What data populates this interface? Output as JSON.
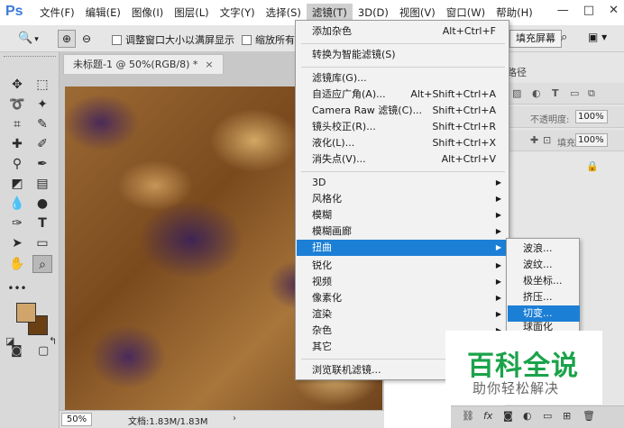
{
  "app": {
    "logo": "Ps"
  },
  "menubar": {
    "items": [
      {
        "label": "文件(F)"
      },
      {
        "label": "编辑(E)"
      },
      {
        "label": "图像(I)"
      },
      {
        "label": "图层(L)"
      },
      {
        "label": "文字(Y)"
      },
      {
        "label": "选择(S)"
      },
      {
        "label": "滤镜(T)"
      },
      {
        "label": "3D(D)"
      },
      {
        "label": "视图(V)"
      },
      {
        "label": "窗口(W)"
      },
      {
        "label": "帮助(H)"
      }
    ],
    "active_index": 6
  },
  "window_controls": {
    "minimize": "—",
    "restore": "□",
    "close": "✕"
  },
  "options_bar": {
    "resize_windows_label": "调整窗口大小以满屏显示",
    "zoom_all_label": "缩放所有",
    "fill_screen_label": "填充屏幕"
  },
  "document": {
    "tab_title": "未标题-1 @ 50%(RGB/8) *",
    "close": "×"
  },
  "statusbar": {
    "zoom": "50%",
    "doc_info": "文档:1.83M/1.83M",
    "arrow": "›"
  },
  "right_panel": {
    "tab_fragment": "路径",
    "opacity_label": "不透明度:",
    "opacity_value": "100%",
    "fill_label": "填充:",
    "fill_value": "100%",
    "bottom_icons": [
      "fx"
    ]
  },
  "filter_menu": {
    "items": [
      {
        "label": "添加杂色",
        "shortcut": "Alt+Ctrl+F"
      },
      {
        "label": "转换为智能滤镜(S)",
        "shortcut": ""
      },
      {
        "label": "滤镜库(G)...",
        "shortcut": ""
      },
      {
        "label": "自适应广角(A)...",
        "shortcut": "Alt+Shift+Ctrl+A"
      },
      {
        "label": "Camera Raw 滤镜(C)...",
        "shortcut": "Shift+Ctrl+A"
      },
      {
        "label": "镜头校正(R)...",
        "shortcut": "Shift+Ctrl+R"
      },
      {
        "label": "液化(L)...",
        "shortcut": "Shift+Ctrl+X"
      },
      {
        "label": "消失点(V)...",
        "shortcut": "Alt+Ctrl+V"
      },
      {
        "label": "3D",
        "submenu": true
      },
      {
        "label": "风格化",
        "submenu": true
      },
      {
        "label": "模糊",
        "submenu": true
      },
      {
        "label": "模糊画廊",
        "submenu": true
      },
      {
        "label": "扭曲",
        "submenu": true,
        "highlighted": true
      },
      {
        "label": "锐化",
        "submenu": true
      },
      {
        "label": "视频",
        "submenu": true
      },
      {
        "label": "像素化",
        "submenu": true
      },
      {
        "label": "渲染",
        "submenu": true
      },
      {
        "label": "杂色",
        "submenu": true
      },
      {
        "label": "其它",
        "submenu": true
      },
      {
        "label": "浏览联机滤镜...",
        "shortcut": ""
      }
    ]
  },
  "distort_submenu": {
    "items": [
      {
        "label": "波浪..."
      },
      {
        "label": "波纹..."
      },
      {
        "label": "极坐标..."
      },
      {
        "label": "挤压..."
      },
      {
        "label": "切变...",
        "highlighted": true
      },
      {
        "label": "球面化"
      }
    ]
  },
  "watermark": {
    "title": "百科全说",
    "subtitle": "助你轻松解决"
  },
  "colors": {
    "accent": "#1c7fd6",
    "foreground_swatch": "#cfa56b",
    "background_swatch": "#6b3f14",
    "watermark_green": "#1aa34a"
  }
}
